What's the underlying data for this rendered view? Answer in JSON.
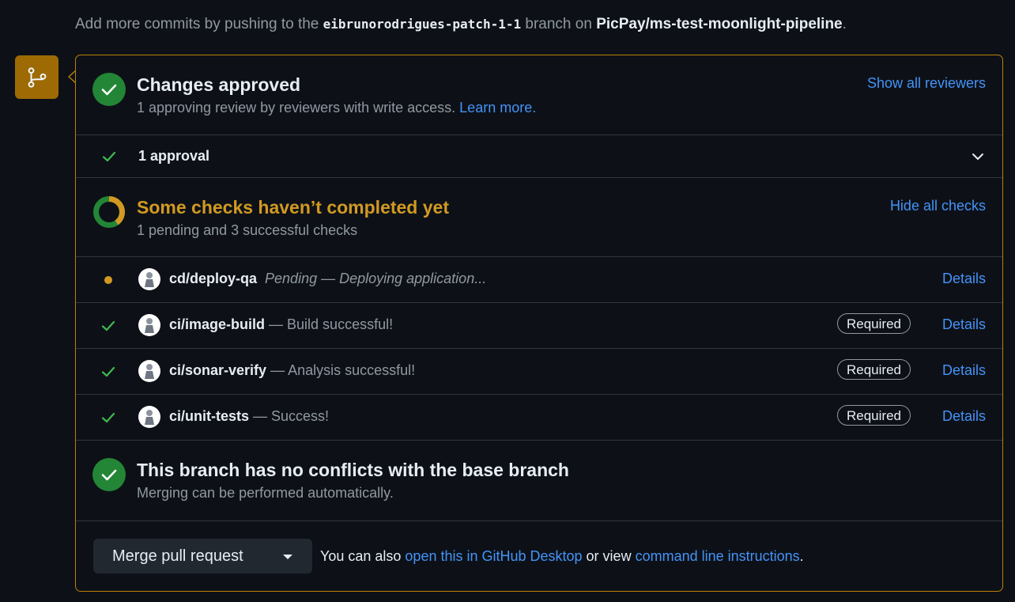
{
  "top_note": {
    "prefix": "Add more commits by pushing to the ",
    "branch": "eibrunorodrigues-patch-1-1",
    "middle": " branch on ",
    "repo": "PicPay/ms-test-moonlight-pipeline",
    "suffix": "."
  },
  "approval": {
    "title": "Changes approved",
    "subtitle": "1 approving review by reviewers with write access.",
    "learn_more": "Learn more.",
    "show_reviewers": "Show all reviewers",
    "approval_count": "1 approval"
  },
  "checks": {
    "title": "Some checks haven’t completed yet",
    "subtitle": "1 pending and 3 successful checks",
    "hide_link": "Hide all checks",
    "items": [
      {
        "name": "cd/deploy-qa",
        "desc": "Pending — Deploying application...",
        "state": "pending",
        "required": "",
        "details": "Details"
      },
      {
        "name": "ci/image-build",
        "desc": " — Build successful!",
        "state": "success",
        "required": "Required",
        "details": "Details"
      },
      {
        "name": "ci/sonar-verify",
        "desc": " — Analysis successful!",
        "state": "success",
        "required": "Required",
        "details": "Details"
      },
      {
        "name": "ci/unit-tests",
        "desc": " — Success!",
        "state": "success",
        "required": "Required",
        "details": "Details"
      }
    ]
  },
  "conflicts": {
    "title": "This branch has no conflicts with the base branch",
    "subtitle": "Merging can be performed automatically."
  },
  "merge": {
    "button": "Merge pull request",
    "note_prefix": "You can also ",
    "desktop_link": "open this in GitHub Desktop",
    "note_middle": " or view ",
    "cli_link": "command line instructions",
    "note_suffix": "."
  },
  "colors": {
    "success": "#238636",
    "pending": "#d29922",
    "accent_link": "#4493f8",
    "border_warning": "#bb8009"
  }
}
